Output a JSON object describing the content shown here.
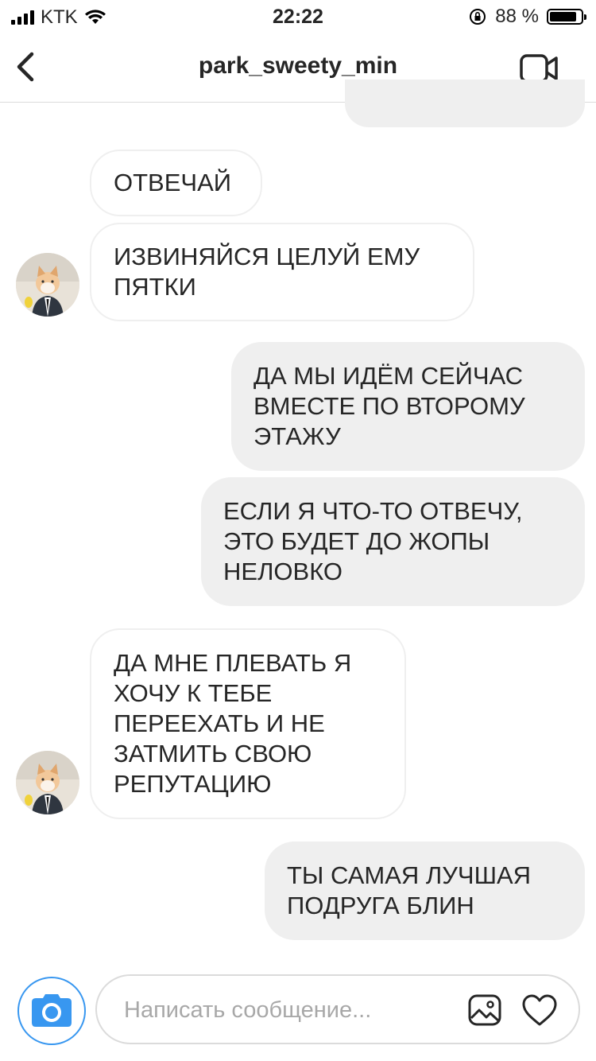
{
  "status_bar": {
    "carrier": "KTK",
    "time": "22:22",
    "battery_label": "88 %",
    "battery_level": 0.88
  },
  "header": {
    "username": "park_sweety_min"
  },
  "messages": [
    {
      "sender": "them",
      "text": "ОТВЕЧАЙ"
    },
    {
      "sender": "them",
      "text": "ИЗВИНЯЙСЯ ЦЕЛУЙ ЕМУ\nПЯТКИ"
    },
    {
      "sender": "me",
      "text": "ДА МЫ ИДЁМ СЕЙЧАС\nВМЕСТЕ ПО ВТОРОМУ\nЭТАЖУ"
    },
    {
      "sender": "me",
      "text": "ЕСЛИ Я ЧТО-ТО ОТВЕЧУ,\nЭТО БУДЕТ ДО ЖОПЫ\nНЕЛОВКО"
    },
    {
      "sender": "them",
      "text": "ДА МНЕ ПЛЕВАТЬ Я\nХОЧУ К ТЕБЕ\nПЕРЕЕХАТЬ И НЕ\nЗАТМИТЬ СВОЮ\nРЕПУТАЦИЮ"
    },
    {
      "sender": "me",
      "text": "ТЫ САМАЯ ЛУЧШАЯ\nПОДРУГА БЛИН"
    }
  ],
  "composer": {
    "placeholder": "Написать сообщение..."
  },
  "icons": {
    "back": "chevron-left-icon",
    "video": "video-camera-icon",
    "camera": "camera-icon",
    "gallery": "gallery-icon",
    "heart": "heart-icon"
  },
  "colors": {
    "accent": "#3897f0",
    "outgoing_bubble": "#efefef",
    "incoming_border": "#efefef"
  }
}
